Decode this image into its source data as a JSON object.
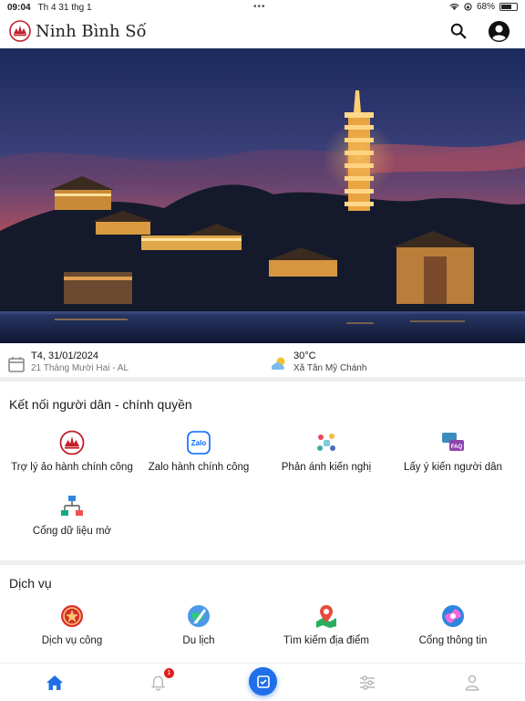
{
  "status_bar": {
    "time": "09:04",
    "date": "Th 4 31 thg 1",
    "battery": "68%"
  },
  "header": {
    "title": "Ninh Bình Số"
  },
  "info": {
    "date": "T4, 31/01/2024",
    "lunar_date": "21 Tháng Mười Hai - AL",
    "temperature": "30°C",
    "location": "Xã Tân Mỹ Chánh"
  },
  "connect_section": {
    "title": "Kết nối người dân - chính quyền",
    "items": [
      {
        "label": "Trợ lý ảo hành chính công",
        "icon": "logo-icon"
      },
      {
        "label": "Zalo hành chính công",
        "icon": "zalo-icon"
      },
      {
        "label": "Phản ánh kiến nghị",
        "icon": "feedback-icon"
      },
      {
        "label": "Lấy ý kiến người dân",
        "icon": "faq-icon"
      },
      {
        "label": "Cổng dữ liệu mở",
        "icon": "network-icon"
      }
    ]
  },
  "services_section": {
    "title": "Dịch vụ",
    "items": [
      {
        "label": "Dịch vụ công",
        "icon": "emblem-icon"
      },
      {
        "label": "Du lịch",
        "icon": "travel-icon"
      },
      {
        "label": "Tìm kiếm địa điểm",
        "icon": "map-pin-icon"
      },
      {
        "label": "Cổng thông tin",
        "icon": "portal-icon"
      }
    ]
  },
  "bottom_nav": {
    "notification_count": "1",
    "accent": "#1f6fe8"
  }
}
